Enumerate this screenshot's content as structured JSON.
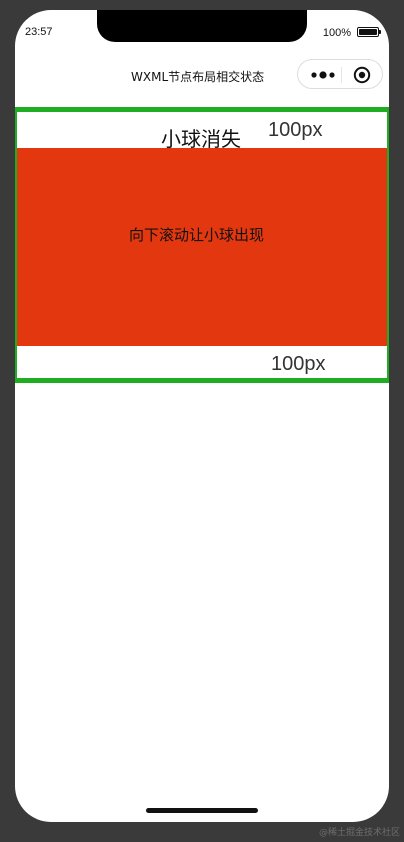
{
  "status_bar": {
    "time": "23:57",
    "battery_percent": "100%"
  },
  "nav": {
    "title": "WXML节点布局相交状态",
    "menu_icon": "more-dots-icon",
    "close_icon": "target-circle-icon"
  },
  "content": {
    "ball_text": "小球消失",
    "top_margin_label": "100px",
    "scroll_hint": "向下滚动让小球出现",
    "bottom_margin_label": "100px"
  },
  "colors": {
    "frame_border": "#1fae22",
    "block_fill": "#e3370f"
  },
  "watermark": "@稀土掘金技术社区"
}
